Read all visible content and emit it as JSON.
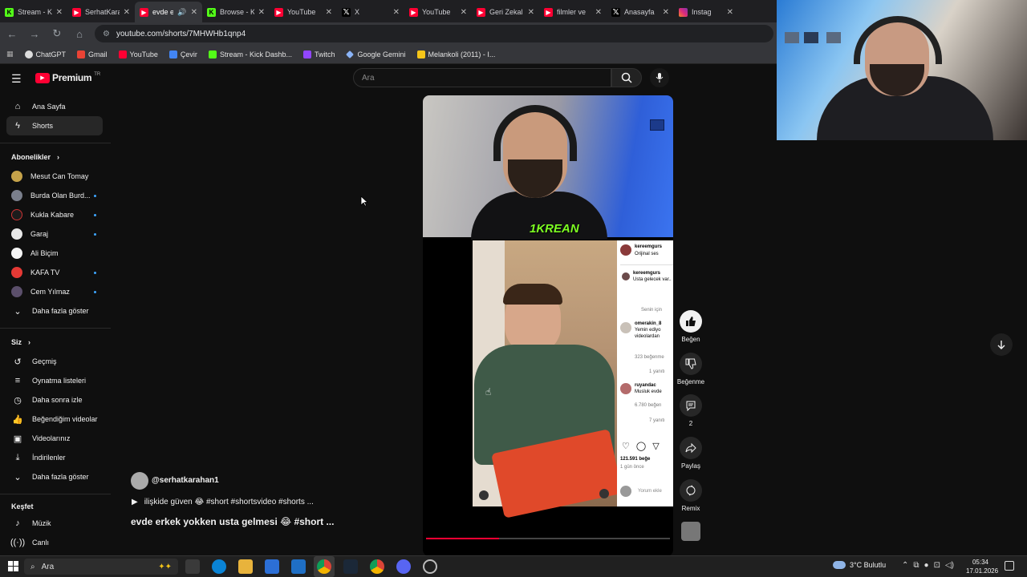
{
  "browser": {
    "tabs": [
      {
        "title": "Stream - K",
        "icon": "kick"
      },
      {
        "title": "SerhatKara",
        "icon": "youtube"
      },
      {
        "title": "evde e",
        "icon": "youtube",
        "active": true
      },
      {
        "title": "Browse - K",
        "icon": "kick"
      },
      {
        "title": "YouTube",
        "icon": "youtube"
      },
      {
        "title": "X",
        "icon": "x"
      },
      {
        "title": "YouTube",
        "icon": "youtube"
      },
      {
        "title": "Geri Zekal",
        "icon": "youtube"
      },
      {
        "title": "filmler ve",
        "icon": "youtube"
      },
      {
        "title": "Anasayfa",
        "icon": "x"
      },
      {
        "title": "Instag",
        "icon": "instagram"
      }
    ],
    "url": "youtube.com/shorts/7MHWHb1qnp4",
    "bookmarks": [
      "ChatGPT",
      "Gmail",
      "YouTube",
      "Çevir",
      "Stream - Kick Dashb...",
      "Twitch",
      "Google Gemini",
      "Melankoli (2011) - I..."
    ]
  },
  "youtube": {
    "logo": "Premium",
    "logo_sup": "TR",
    "search_placeholder": "Ara",
    "nav": [
      {
        "label": "Ana Sayfa",
        "icon": "home-icon"
      },
      {
        "label": "Shorts",
        "icon": "shorts-icon",
        "active": true
      }
    ],
    "subs_heading": "Abonelikler",
    "subscriptions": [
      {
        "label": "Mesut Can Tomay",
        "dot": false
      },
      {
        "label": "Burda Olan Burd...",
        "dot": true
      },
      {
        "label": "Kukla Kabare",
        "dot": true
      },
      {
        "label": "Garaj",
        "dot": true
      },
      {
        "label": "Ali Biçim",
        "dot": false
      },
      {
        "label": "KAFA TV",
        "dot": true
      },
      {
        "label": "Cem Yılmaz",
        "dot": true
      }
    ],
    "show_more": "Daha fazla göster",
    "you_heading": "Siz",
    "you_items": [
      {
        "label": "Geçmiş",
        "icon": "history-icon"
      },
      {
        "label": "Oynatma listeleri",
        "icon": "playlist-icon"
      },
      {
        "label": "Daha sonra izle",
        "icon": "clock-icon"
      },
      {
        "label": "Beğendiğim videolar",
        "icon": "like-icon"
      },
      {
        "label": "Videolarınız",
        "icon": "video-icon"
      },
      {
        "label": "İndirilenler",
        "icon": "download-icon"
      }
    ],
    "show_more_2": "Daha fazla göster",
    "explore_heading": "Keşfet",
    "explore_items": [
      {
        "label": "Müzik",
        "icon": "music-icon"
      },
      {
        "label": "Canlı",
        "icon": "live-icon"
      }
    ],
    "short": {
      "channel": "@serhatkarahan1",
      "music": "ilişkide güven 😂 #short #shortsvideo #shorts ...",
      "title": "evde erkek yokken usta gelmesi 😂 #short ...",
      "overlay_brand": "1KREAN",
      "progress": 0.3
    },
    "actions": {
      "like": "Beğen",
      "dislike": "Beğenme",
      "comments": "2",
      "share": "Paylaş",
      "remix": "Remix"
    },
    "instagram_panel": {
      "user": "kereemgurs",
      "audio": "Orijinal ses",
      "c1_user": "kereemgurs",
      "c1_text": "Usta gelecek var..",
      "for_you": "Senin için",
      "c2_user": "omerakin_8",
      "c2_text": "Yemin ediyo videolardan",
      "c2_likes": "323 beğenme",
      "c2_reply": "1 yanıtı",
      "c3_user": "ruyandac",
      "c3_text": "Musluk evde",
      "c3_likes": "6.780 beğen",
      "c3_reply": "7 yanıtı",
      "likes": "121.591 beğe",
      "time": "1 gün önce",
      "add_comment": "Yorum ekle"
    }
  },
  "taskbar": {
    "search": "Ara",
    "weather": "3°C Bulutlu",
    "time": "05:34",
    "date": "17.01.2026"
  }
}
